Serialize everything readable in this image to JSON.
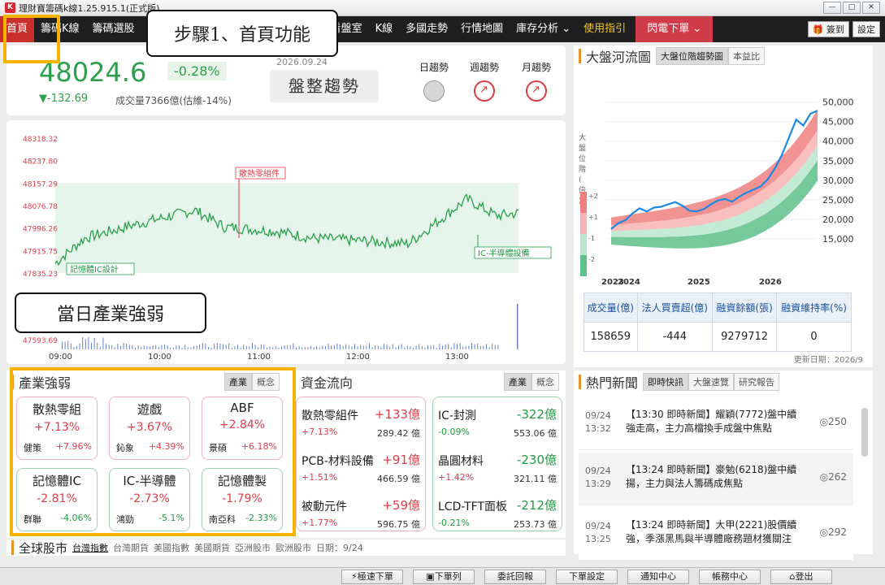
{
  "window": {
    "title": "理財寶籌碼k線1.25.915.1(正式版)",
    "app_icon": "K"
  },
  "nav": {
    "items": [
      "首頁",
      "籌碼K線",
      "籌碼選股",
      "看盤室",
      "K線",
      "多國走勢",
      "行情地圖",
      "庫存分析 ⌄",
      "使用指引",
      "閃電下單 ⌄"
    ],
    "signin": "簽到",
    "settings": "設定"
  },
  "callouts": {
    "step1": "步驟1、首頁功能",
    "industry": "當日產業強弱"
  },
  "index": {
    "value": "48024.6",
    "pct": "-0.28%",
    "change": "▼-132.69",
    "volume": "成交量7366億(估維-14%)",
    "date": "2026.09.24",
    "trend_label": "盤整趨勢",
    "trends": [
      {
        "label": "日趨勢",
        "state": "neutral"
      },
      {
        "label": "週趨勢",
        "state": "up"
      },
      {
        "label": "月趨勢",
        "state": "up"
      }
    ]
  },
  "chart_data": [
    {
      "type": "line",
      "name": "intraday",
      "yticks": [
        "48318.32",
        "48237.80",
        "48157.29",
        "48076.78",
        "47996.26",
        "47915.75",
        "47835.23",
        "47593.69"
      ],
      "xticks": [
        "09:00",
        "10:00",
        "11:00",
        "12:00",
        "13:00"
      ],
      "annotations": [
        "散熱零組件",
        "記憶體IC設計",
        "IC-半導體設備"
      ],
      "ylim": [
        47835.23,
        48318.32
      ],
      "color": "#2aa04a"
    },
    {
      "type": "line",
      "name": "大盤河流圖",
      "yticks": [
        "50,000",
        "45,000",
        "40,000",
        "35,000",
        "30,000",
        "25,000",
        "20,000",
        "15,000"
      ],
      "xticks": [
        "2023",
        "2024",
        "2025",
        "2026"
      ],
      "ylabel": "大盤位階(倍)",
      "band_labels": [
        "+2",
        "+1",
        "-1",
        "-2"
      ],
      "ylim": [
        10000,
        52000
      ]
    }
  ],
  "river": {
    "title": "大盤河流圖",
    "tabs": [
      "大盤位階趨勢圖",
      "本益比"
    ],
    "headers": [
      "成交量(億)",
      "法人買賣超(億)",
      "融資餘額(張)",
      "融資維持率(%)"
    ],
    "values": [
      "158659",
      "-444",
      "9279712",
      "0"
    ],
    "update": "更新日期：2026/9"
  },
  "sector": {
    "title": "產業強弱",
    "tabs": [
      "產業",
      "概念"
    ],
    "cards": [
      {
        "name": "散熱零組",
        "pct": "+7.13%",
        "stock": "健策",
        "spct": "+7.96%",
        "up": true
      },
      {
        "name": "遊戲",
        "pct": "+3.67%",
        "stock": "鈊象",
        "spct": "+4.39%",
        "up": true
      },
      {
        "name": "ABF",
        "pct": "+2.84%",
        "stock": "景碩",
        "spct": "+6.18%",
        "up": true
      },
      {
        "name": "記憶體IC",
        "pct": "-2.81%",
        "stock": "群聯",
        "spct": "-4.06%",
        "up": false
      },
      {
        "name": "IC-半導體",
        "pct": "-2.73%",
        "stock": "鴻勁",
        "spct": "-5.1%",
        "up": false
      },
      {
        "name": "記憶體製",
        "pct": "-1.79%",
        "stock": "南亞科",
        "spct": "-2.33%",
        "up": false
      }
    ]
  },
  "fund": {
    "title": "資金流向",
    "tabs": [
      "產業",
      "概念"
    ],
    "inflow": [
      {
        "name": "散熱零組件",
        "value": "+133億",
        "pct": "+7.13%",
        "amt": "289.42 億"
      },
      {
        "name": "PCB-材料設備",
        "value": "+91億",
        "pct": "+1.51%",
        "amt": "466.59 億"
      },
      {
        "name": "被動元件",
        "value": "+59億",
        "pct": "+1.77%",
        "amt": "596.75 億"
      }
    ],
    "outflow": [
      {
        "name": "IC-封測",
        "value": "-322億",
        "pct": "-0.09%",
        "amt": "553.06 億"
      },
      {
        "name": "晶圓材料",
        "value": "-230億",
        "pct": "+1.42%",
        "amt": "321.11 億"
      },
      {
        "name": "LCD-TFT面板",
        "value": "-212億",
        "pct": "-0.21%",
        "amt": "253.73 億"
      }
    ]
  },
  "news": {
    "title": "熱門新聞",
    "tabs": [
      "即時快訊",
      "大盤速覽",
      "研究報告"
    ],
    "items": [
      {
        "date": "09/24",
        "time": "13:32",
        "text": "【13:30 即時新聞】耀穎(7772)盤中續強走高，主力高檔換手成盤中焦點",
        "views": "250"
      },
      {
        "date": "09/24",
        "time": "13:29",
        "text": "【13:24 即時新聞】豪勉(6218)盤中續揚，主力與法人籌碼成焦點",
        "views": "262"
      },
      {
        "date": "09/24",
        "time": "13:25",
        "text": "【13:24 即時新聞】大甲(2221)股價續強，季漲黑馬與半導體廠務題材獲關注",
        "views": "292"
      }
    ]
  },
  "global": {
    "title": "全球股市",
    "tabs": [
      "台灣指數",
      "台灣期貨",
      "美國指數",
      "美國期貨",
      "亞洲股市",
      "歐洲股市"
    ],
    "date": "日期：9/24"
  },
  "bottom": [
    "⚡極速下單",
    "▣下單列",
    "委託回報",
    "下單設定",
    "通知中心",
    "帳務中心",
    "⌂登出"
  ],
  "colors": {
    "up": "#e23b48",
    "down": "#239a45",
    "accent": "#f5b400",
    "nav": "#1f1f1f"
  }
}
